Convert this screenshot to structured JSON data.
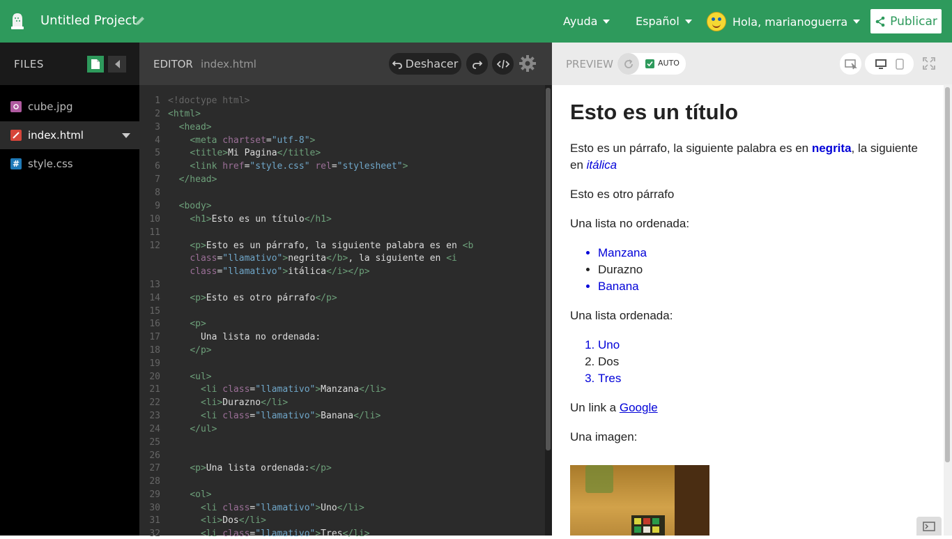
{
  "app": {
    "project_title": "Untitled Project",
    "menu_help": "Ayuda",
    "menu_language": "Español",
    "user_greeting": "Hola, marianoguerra",
    "publish_label": "Publicar"
  },
  "files_panel": {
    "title": "FILES",
    "items": [
      {
        "name": "cube.jpg",
        "icon": "image-file-icon",
        "color": "#b05aa0"
      },
      {
        "name": "index.html",
        "icon": "html-file-icon",
        "color": "#d6453a"
      },
      {
        "name": "style.css",
        "icon": "css-file-icon",
        "color": "#1f7ab8"
      }
    ]
  },
  "editor": {
    "title": "EDITOR",
    "filename": "index.html",
    "undo_label": "Deshacer",
    "lines": [
      {
        "n": "1",
        "top": 0
      },
      {
        "n": "2"
      },
      {
        "n": "3"
      },
      {
        "n": "4"
      },
      {
        "n": "5"
      },
      {
        "n": "6"
      },
      {
        "n": "7"
      },
      {
        "n": "8"
      },
      {
        "n": "9"
      },
      {
        "n": "10"
      },
      {
        "n": "11"
      },
      {
        "n": "12"
      }
    ],
    "code": {
      "l1": "<!doctype html>",
      "l2_tag": "<html>",
      "l3_tag": "<head>",
      "l4_tag": "<meta",
      "l4_attr": "chartset",
      "l4_val": "\"utf-8\"",
      "l5_open": "<title>",
      "l5_text": "Mi Pagina",
      "l5_close": "</title>",
      "l6_tag": "<link",
      "l6_attr1": "href",
      "l6_val1": "\"style.css\"",
      "l6_attr2": "rel",
      "l6_val2": "\"stylesheet\"",
      "l7_tag": "</head>",
      "l9_tag": "<body>",
      "l10_open": "<h1>",
      "l10_text": "Esto es un título",
      "l10_close": "</h1>",
      "l12_open": "<p>",
      "l12_text": "Esto es un párrafo, la siguiente palabra es en ",
      "l12_b": "<b",
      "l12b_attr": "class",
      "l12b_val": "\"llamativo\"",
      "l12b_text1": "negrita",
      "l12b_bclose": "</b>",
      "l12b_text2": ", la siguiente en ",
      "l12b_i": "<i",
      "l12c_attr": "class",
      "l12c_val": "\"llamativo\"",
      "l12c_text": "itálica",
      "l12c_close": "</i></p>",
      "l14_open": "<p>",
      "l14_text": "Esto es otro párrafo",
      "l14_close": "</p>",
      "l16_tag": "<p>",
      "l17_text": "Una lista no ordenada:",
      "l18_tag": "</p>",
      "l20_tag": "<ul>",
      "l21_open": "<li",
      "l21_attr": "class",
      "l21_val": "\"llamativo\"",
      "l21_text": "Manzana",
      "l21_close": "</li>",
      "l22_open": "<li>",
      "l22_text": "Durazno",
      "l22_close": "</li>",
      "l23_open": "<li",
      "l23_attr": "class",
      "l23_val": "\"llamativo\"",
      "l23_text": "Banana",
      "l23_close": "</li>",
      "l24_tag": "</ul>",
      "l27_open": "<p>",
      "l27_text": "Una lista ordenada:",
      "l27_close": "</p>",
      "l29_tag": "<ol>",
      "l30_open": "<li",
      "l30_attr": "class",
      "l30_val": "\"llamativo\"",
      "l30_text": "Uno",
      "l30_close": "</li>",
      "l31_open": "<li>",
      "l31_text": "Dos",
      "l31_close": "</li>",
      "l32_open": "<li",
      "l32_attr": "class",
      "l32_val": "\"llamativo\"",
      "l32_text": "Tres",
      "l32_close": "</li>"
    }
  },
  "preview": {
    "title": "PREVIEW",
    "auto_label": "AUTO",
    "h1": "Esto es un título",
    "p1_a": "Esto es un párrafo, la siguiente palabra es en ",
    "p1_bold": "negrita",
    "p1_b": ", la siguiente en ",
    "p1_italic": "itálica",
    "p2": "Esto es otro párrafo",
    "p3": "Una lista no ordenada:",
    "ul": [
      "Manzana",
      "Durazno",
      "Banana"
    ],
    "p4": "Una lista ordenada:",
    "ol": [
      "Uno",
      "Dos",
      "Tres"
    ],
    "link_prefix": "Un link a ",
    "link_text": "Google",
    "p6": "Una imagen:"
  }
}
